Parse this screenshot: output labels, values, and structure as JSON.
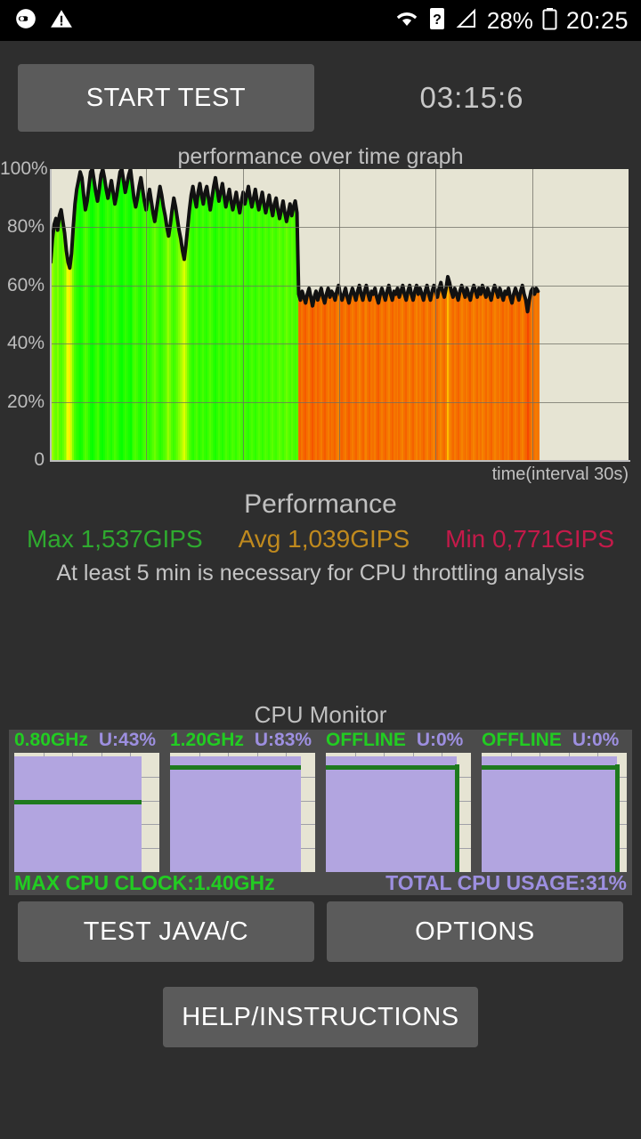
{
  "statusbar": {
    "icons_left": [
      "sync-icon",
      "warning-icon"
    ],
    "icons_right": [
      "wifi-icon",
      "sim-unknown-icon",
      "signal-icon"
    ],
    "battery_percent": "28%",
    "time": "20:25"
  },
  "toolbar": {
    "start_label": "START TEST",
    "timer": "03:15:6"
  },
  "chart_data": {
    "type": "area",
    "title": "performance over time graph",
    "xlabel": "time(interval 30s)",
    "ylabel": "",
    "ylim": [
      0,
      100
    ],
    "ytick_labels": [
      "100%",
      "80%",
      "60%",
      "40%",
      "20%",
      "0"
    ],
    "ytick_values": [
      100,
      80,
      60,
      40,
      20,
      0
    ],
    "grid": true,
    "x_gridline_count": 6,
    "data_end_fraction": 0.845,
    "values": [
      68,
      76,
      81,
      83,
      79,
      84,
      86,
      82,
      78,
      72,
      68,
      66,
      71,
      80,
      88,
      93,
      96,
      99,
      97,
      91,
      86,
      89,
      94,
      99,
      100,
      96,
      92,
      89,
      93,
      98,
      100,
      97,
      93,
      90,
      93,
      96,
      92,
      88,
      91,
      95,
      99,
      100,
      96,
      92,
      95,
      98,
      100,
      95,
      90,
      87,
      90,
      94,
      97,
      93,
      89,
      86,
      90,
      93,
      89,
      85,
      82,
      86,
      90,
      94,
      91,
      87,
      84,
      80,
      77,
      81,
      86,
      90,
      87,
      83,
      79,
      76,
      72,
      69,
      74,
      80,
      86,
      91,
      94,
      90,
      87,
      92,
      95,
      91,
      88,
      92,
      94,
      90,
      86,
      90,
      94,
      97,
      93,
      89,
      92,
      95,
      91,
      87,
      90,
      93,
      89,
      86,
      89,
      92,
      88,
      85,
      89,
      92,
      88,
      91,
      94,
      90,
      87,
      90,
      93,
      89,
      86,
      89,
      92,
      88,
      85,
      88,
      91,
      87,
      84,
      88,
      90,
      86,
      83,
      86,
      89,
      85,
      82,
      85,
      88,
      84,
      87,
      89,
      85,
      57,
      55,
      58,
      56,
      54,
      57,
      59,
      56,
      53,
      56,
      58,
      55,
      57,
      59,
      56,
      54,
      57,
      59,
      56,
      58,
      57,
      55,
      58,
      60,
      57,
      55,
      57,
      59,
      56,
      54,
      57,
      59,
      57,
      55,
      58,
      60,
      57,
      55,
      58,
      60,
      57,
      55,
      58,
      57,
      59,
      56,
      54,
      57,
      59,
      57,
      55,
      58,
      60,
      57,
      55,
      58,
      57,
      59,
      56,
      58,
      60,
      57,
      55,
      58,
      60,
      57,
      55,
      58,
      60,
      57,
      59,
      57,
      55,
      58,
      60,
      57,
      55,
      58,
      60,
      58,
      56,
      59,
      61,
      58,
      56,
      59,
      63,
      61,
      58,
      56,
      59,
      57,
      55,
      58,
      60,
      58,
      56,
      59,
      57,
      55,
      58,
      60,
      58,
      56,
      59,
      57,
      60,
      58,
      56,
      59,
      57,
      55,
      58,
      60,
      58,
      56,
      59,
      57,
      55,
      58,
      57,
      59,
      56,
      54,
      57,
      59,
      57,
      55,
      58,
      60,
      57,
      55,
      51,
      55,
      58,
      59,
      57,
      59,
      58
    ]
  },
  "performance": {
    "heading": "Performance",
    "max_label": "Max 1,537GIPS",
    "avg_label": "Avg 1,039GIPS",
    "min_label": "Min 0,771GIPS",
    "max_color": "#2faa2f",
    "avg_color": "#c08a1e",
    "min_color": "#c41a4a",
    "note": "At least 5 min is necessary for CPU throttling analysis"
  },
  "cpu_monitor": {
    "heading": "CPU Monitor",
    "cores": [
      {
        "freq": "0.80GHz",
        "usage": "U:43%",
        "freq_line_pct": 57,
        "fill_pct": 97,
        "drop_at_pct": 88
      },
      {
        "freq": "1.20GHz",
        "usage": "U:83%",
        "freq_line_pct": 86,
        "fill_pct": 97,
        "drop_at_pct": 90
      },
      {
        "freq": "OFFLINE",
        "usage": "U:0%",
        "freq_line_pct": 86,
        "fill_pct": 97,
        "drop_at_pct": 90
      },
      {
        "freq": "OFFLINE",
        "usage": "U:0%",
        "freq_line_pct": 86,
        "fill_pct": 97,
        "drop_at_pct": 93
      }
    ],
    "max_clock": "MAX CPU CLOCK:1.40GHz",
    "total_usage": "TOTAL CPU USAGE:31%"
  },
  "buttons": {
    "test_java": "TEST JAVA/C",
    "options": "OPTIONS",
    "help": "HELP/INSTRUCTIONS"
  }
}
